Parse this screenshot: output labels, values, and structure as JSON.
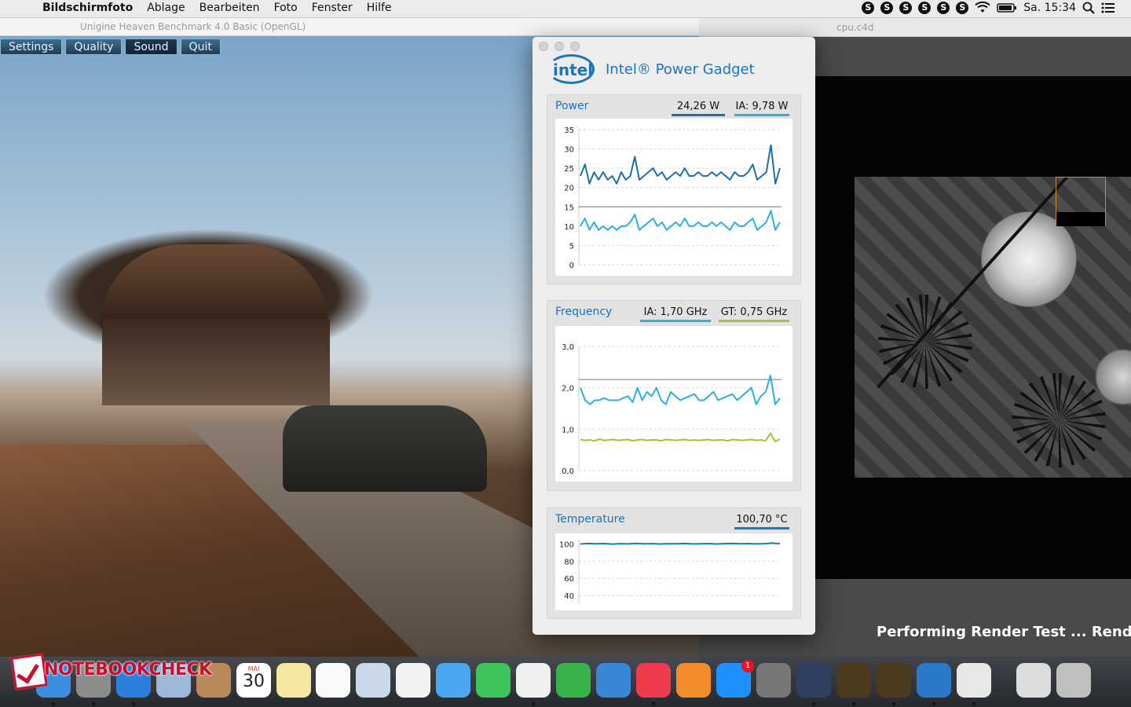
{
  "menubar": {
    "apple": "",
    "app": "Bildschirmfoto",
    "menus": [
      "Ablage",
      "Bearbeiten",
      "Foto",
      "Fenster",
      "Hilfe"
    ],
    "status_icons": [
      "S",
      "S",
      "S",
      "S",
      "S",
      "S"
    ],
    "clock": "Sa. 15:34"
  },
  "heaven": {
    "title": "Unigine Heaven Benchmark 4.0 Basic (OpenGL)",
    "buttons": [
      {
        "label": "Settings",
        "active": false
      },
      {
        "label": "Quality",
        "active": false
      },
      {
        "label": "Sound",
        "active": true
      },
      {
        "label": "Quit",
        "active": false
      }
    ]
  },
  "c4d": {
    "title": "cpu.c4d",
    "status": "Performing Render Test ... Rendering"
  },
  "gadget": {
    "title": "Intel® Power Gadget",
    "logo_text": "intel",
    "colors": {
      "power_total": "#1d6fa9",
      "power_ia": "#2cb0dc",
      "gt": "#a8c23a",
      "temp": "#1f7ab8"
    },
    "power": {
      "label": "Power",
      "total": "24,26 W",
      "ia": "IA: 9,78 W"
    },
    "frequency": {
      "label": "Frequency",
      "ia": "IA: 1,70 GHz",
      "gt": "GT: 0,75 GHz"
    },
    "temperature": {
      "label": "Temperature",
      "value": "100,70 °C"
    }
  },
  "chart_data": [
    {
      "type": "line",
      "title": "Power",
      "ylim": [
        0,
        35
      ],
      "yticks": [
        "35",
        "30",
        "25",
        "20",
        "15",
        "10",
        "5",
        "0"
      ],
      "reference_line": 15,
      "series": [
        {
          "values": [
            23,
            26,
            21,
            24,
            22,
            24,
            22,
            23,
            21,
            24,
            22,
            23,
            28,
            22,
            23,
            24,
            25,
            23,
            24,
            22,
            23,
            24,
            23,
            25,
            23,
            23,
            24,
            23,
            23,
            24,
            23,
            24,
            23,
            22,
            24,
            23,
            23,
            24,
            26,
            22,
            23,
            24,
            31,
            21,
            25
          ]
        },
        {
          "values": [
            10,
            12,
            9,
            11,
            9,
            10,
            9,
            10,
            9,
            10,
            10,
            11,
            13,
            9,
            10,
            11,
            12,
            10,
            11,
            9,
            10,
            11,
            10,
            12,
            10,
            10,
            11,
            10,
            10,
            11,
            10,
            11,
            10,
            9,
            11,
            10,
            10,
            11,
            12,
            9,
            10,
            11,
            14,
            9,
            11
          ]
        }
      ]
    },
    {
      "type": "line",
      "title": "Frequency",
      "ylim": [
        0,
        3
      ],
      "yticks": [
        "3,0",
        "2,0",
        "1,0",
        "0,0"
      ],
      "reference_line": 2.2,
      "series": [
        {
          "values": [
            2.0,
            1.7,
            1.6,
            1.7,
            1.7,
            1.75,
            1.7,
            1.7,
            1.7,
            1.75,
            1.8,
            1.65,
            2.0,
            1.7,
            1.9,
            1.8,
            2.0,
            1.7,
            1.6,
            1.9,
            1.8,
            1.7,
            1.75,
            1.8,
            1.85,
            1.7,
            1.7,
            1.8,
            1.9,
            1.7,
            1.75,
            1.8,
            1.85,
            1.7,
            1.8,
            1.9,
            2.0,
            1.6,
            1.8,
            1.9,
            2.3,
            1.6,
            1.75
          ]
        },
        {
          "values": [
            0.75,
            0.73,
            0.74,
            0.72,
            0.76,
            0.73,
            0.74,
            0.75,
            0.73,
            0.74,
            0.75,
            0.72,
            0.74,
            0.75,
            0.73,
            0.74,
            0.74,
            0.72,
            0.75,
            0.74,
            0.73,
            0.74,
            0.75,
            0.73,
            0.74,
            0.73,
            0.74,
            0.75,
            0.73,
            0.74,
            0.74,
            0.72,
            0.75,
            0.74,
            0.73,
            0.74,
            0.75,
            0.73,
            0.74,
            0.72,
            0.9,
            0.7,
            0.76
          ]
        }
      ]
    },
    {
      "type": "line",
      "title": "Temperature",
      "ylim": [
        30,
        105
      ],
      "yticks": [
        "100",
        "80",
        "60",
        "40"
      ],
      "series": [
        {
          "values": [
            100,
            100.5,
            100.2,
            100.4,
            99.9,
            100.3,
            100.1,
            100.6,
            100.2,
            100.4,
            100,
            100.3,
            100.2,
            100.5,
            100.1,
            100.2,
            100.4,
            100,
            100.3,
            100.6,
            100.2,
            100.4,
            100.1,
            100.3,
            101,
            100.4
          ]
        }
      ]
    }
  ],
  "dock": {
    "badge": "1",
    "calendar_month": "MAI",
    "calendar_day": "30",
    "watermark": "NOTEBOOKCHECK",
    "items": [
      "finder-icon",
      "launchpad-icon",
      "safari-icon",
      "mail-icon",
      "contacts-icon",
      "calendar-icon",
      "notes-icon",
      "reminders-icon",
      "preview-icon",
      "photos-icon",
      "messages-icon",
      "facetime-icon",
      "pages-icon",
      "numbers-icon",
      "keynote-icon",
      "itunes-icon",
      "ibooks-icon",
      "app-store-icon",
      "system-preferences-icon",
      "cinema4d-icon",
      "heaven-icon",
      "heaven-icon-2",
      "power-gadget-icon",
      "grab-icon",
      "document-icon",
      "trash-icon"
    ]
  }
}
